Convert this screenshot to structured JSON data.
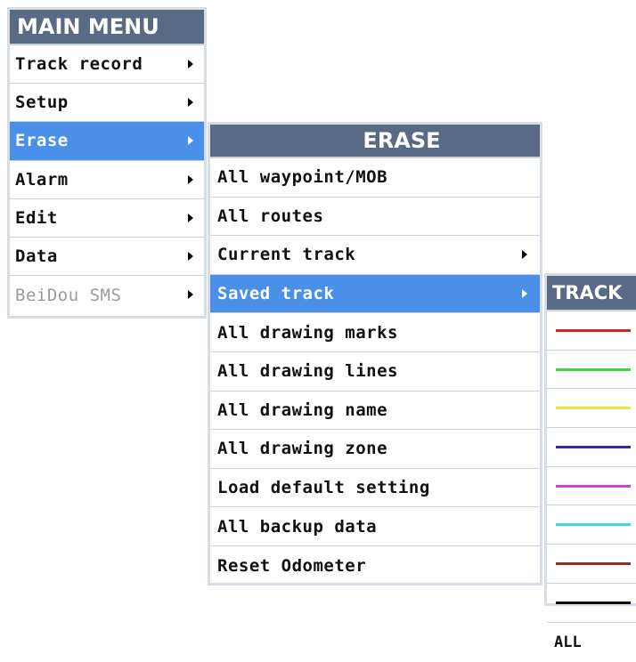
{
  "main_menu": {
    "title": "MAIN MENU",
    "items": [
      {
        "label": "Track record"
      },
      {
        "label": "Setup"
      },
      {
        "label": "Erase"
      },
      {
        "label": "Alarm"
      },
      {
        "label": "Edit"
      },
      {
        "label": "Data"
      },
      {
        "label": "BeiDou SMS"
      }
    ],
    "selected_index": 2
  },
  "erase_menu": {
    "title": "ERASE",
    "items": [
      {
        "label": "All waypoint/MOB"
      },
      {
        "label": "All routes"
      },
      {
        "label": "Current track"
      },
      {
        "label": "Saved track"
      },
      {
        "label": "All drawing marks"
      },
      {
        "label": "All drawing lines"
      },
      {
        "label": "All drawing name"
      },
      {
        "label": "All drawing zone"
      },
      {
        "label": "Load default setting"
      },
      {
        "label": "All backup data"
      },
      {
        "label": "Reset Odometer"
      }
    ],
    "selected_index": 3
  },
  "track_menu": {
    "title": "TRACK",
    "track_colors": [
      "#c62828",
      "#3fd63f",
      "#e8e83a",
      "#2a2ab0",
      "#d23fd2",
      "#3fd8d8",
      "#8b2e2e",
      "#111111"
    ],
    "all_label": "ALL"
  }
}
